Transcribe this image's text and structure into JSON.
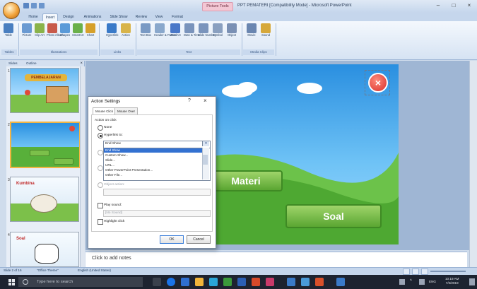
{
  "window": {
    "title": "PPT PEMATERI [Compatibility Mode] - Microsoft PowerPoint",
    "contextual_tab": "Picture Tools"
  },
  "ribbon_tabs": [
    "Home",
    "Insert",
    "Design",
    "Animations",
    "Slide Show",
    "Review",
    "View",
    "Format"
  ],
  "ribbon": {
    "buttons": [
      {
        "label": "Table",
        "icon": "table-icon",
        "color": "#4a7fc0"
      },
      {
        "label": "Picture",
        "icon": "picture-icon",
        "color": "#6a9ad2"
      },
      {
        "label": "Clip Art",
        "icon": "clip-art-icon",
        "color": "#8ab34a"
      },
      {
        "label": "Photo Album",
        "icon": "photo-album-icon",
        "color": "#c85a4a"
      },
      {
        "label": "Shapes",
        "icon": "shapes-icon",
        "color": "#5a9ad8"
      },
      {
        "label": "SmartArt",
        "icon": "smartart-icon",
        "color": "#6ab04a"
      },
      {
        "label": "Chart",
        "icon": "chart-icon",
        "color": "#d6a02a"
      },
      {
        "label": "Hyperlink",
        "icon": "hyperlink-icon",
        "color": "#3a7ac8"
      },
      {
        "label": "Action",
        "icon": "action-icon",
        "color": "#d8b44a"
      },
      {
        "label": "Text Box",
        "icon": "text-box-icon",
        "color": "#7a9ac4"
      },
      {
        "label": "Header & Footer",
        "icon": "header-footer-icon",
        "color": "#8aa8cc"
      },
      {
        "label": "WordArt",
        "icon": "wordart-icon",
        "color": "#4a78c8"
      },
      {
        "label": "Date & Time",
        "icon": "date-time-icon",
        "color": "#7a94bc"
      },
      {
        "label": "Slide Number",
        "icon": "slide-number-icon",
        "color": "#7a94bc"
      },
      {
        "label": "Symbol",
        "icon": "symbol-icon",
        "color": "#8aa0c0"
      },
      {
        "label": "Object",
        "icon": "object-icon",
        "color": "#7a90b4"
      },
      {
        "label": "Movie",
        "icon": "movie-icon",
        "color": "#6a86b0"
      },
      {
        "label": "Sound",
        "icon": "sound-icon",
        "color": "#d6a83a"
      }
    ],
    "groups": [
      "Tables",
      "Illustrations",
      "Links",
      "Text",
      "Media Clips"
    ]
  },
  "panel": {
    "tabs": [
      "Slides",
      "Outline"
    ],
    "slides": [
      {
        "num": "1",
        "title": "PEMBELAJARAN"
      },
      {
        "num": "2",
        "title": ""
      },
      {
        "num": "3",
        "title": "Kumbina"
      },
      {
        "num": "4",
        "title": "Soal"
      }
    ]
  },
  "slide": {
    "button_materi": "Materi",
    "button_soal": "Soal",
    "close_icon": "close-icon"
  },
  "notes_placeholder": "Click to add notes",
  "status": {
    "slide": "Slide 2 of 16",
    "theme": "\"Office Theme\"",
    "language": "English (United States)"
  },
  "dialog": {
    "title": "Action Settings",
    "help": "?",
    "tabs": [
      "Mouse Click",
      "Mouse Over"
    ],
    "section": "Action on click",
    "none_label": "None",
    "hyperlink_label": "Hyperlink to:",
    "hyperlink_value": "End Show",
    "hyperlink_options": [
      "End Show",
      "Custom Show...",
      "Slide...",
      "URL...",
      "Other PowerPoint Presentation...",
      "Other File..."
    ],
    "object_action_label": "Object action:",
    "play_sound_label": "Play sound:",
    "sound_value": "[No Sound]",
    "highlight_label": "Highlight click",
    "ok": "OK",
    "cancel": "Cancel"
  },
  "taskbar": {
    "search_placeholder": "Type here to search",
    "lang": "ENG",
    "time": "10:19 AM",
    "date": "7/2/2019"
  }
}
